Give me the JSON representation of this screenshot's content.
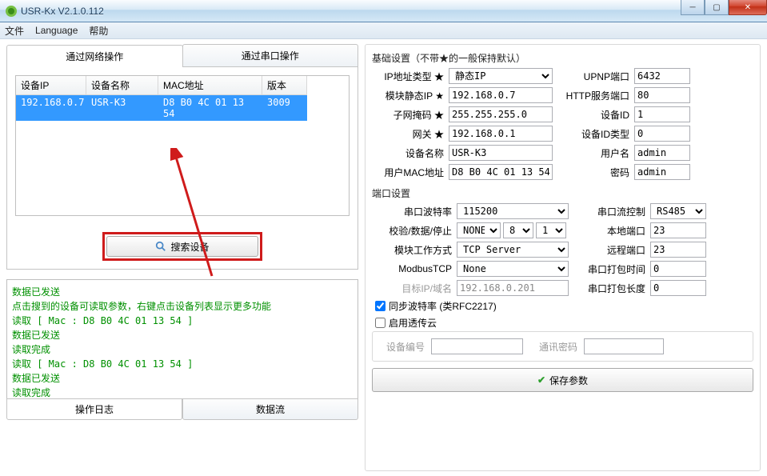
{
  "window": {
    "title": "USR-Kx V2.1.0.112"
  },
  "menu": {
    "file": "文件",
    "language": "Language",
    "help": "帮助"
  },
  "left": {
    "tabs": {
      "network": "通过网络操作",
      "serial": "通过串口操作"
    },
    "columns": {
      "ip": "设备IP",
      "name": "设备名称",
      "mac": "MAC地址",
      "ver": "版本"
    },
    "row": {
      "ip": "192.168.0.7",
      "name": "USR-K3",
      "mac": "D8 B0 4C 01 13 54",
      "ver": "3009"
    },
    "search_btn": "搜索设备",
    "log": [
      "数据已发送",
      "点击搜到的设备可读取参数，右键点击设备列表显示更多功能",
      "读取 [ Mac : D8 B0 4C 01 13 54 ]",
      "数据已发送",
      "读取完成",
      "读取 [ Mac : D8 B0 4C 01 13 54 ]",
      "数据已发送",
      "读取完成"
    ],
    "bottom_tabs": {
      "log": "操作日志",
      "data": "数据流"
    }
  },
  "right": {
    "basic_title": "基础设置（不带★的一般保持默认）",
    "basic": {
      "ip_type_label": "IP地址类型 ★",
      "ip_type_value": "静态IP",
      "upnp_port_label": "UPNP端口",
      "upnp_port_value": "6432",
      "static_ip_label": "模块静态IP ★",
      "static_ip_value": "192.168.0.7",
      "http_port_label": "HTTP服务端口",
      "http_port_value": "80",
      "subnet_label": "子网掩码 ★",
      "subnet_value": "255.255.255.0",
      "dev_id_label": "设备ID",
      "dev_id_value": "1",
      "gateway_label": "网关 ★",
      "gateway_value": "192.168.0.1",
      "dev_id_type_label": "设备ID类型",
      "dev_id_type_value": "0",
      "dev_name_label": "设备名称",
      "dev_name_value": "USR-K3",
      "username_label": "用户名",
      "username_value": "admin",
      "user_mac_label": "用户MAC地址",
      "user_mac_value": "D8 B0 4C 01 13 54",
      "password_label": "密码",
      "password_value": "admin"
    },
    "port_title": "端口设置",
    "port": {
      "baud_label": "串口波特率",
      "baud_value": "115200",
      "flow_label": "串口流控制",
      "flow_value": "RS485",
      "psp_label": "校验/数据/停止",
      "parity": "NONE",
      "databits": "8",
      "stopbits": "1",
      "local_port_label": "本地端口",
      "local_port_value": "23",
      "work_mode_label": "模块工作方式",
      "work_mode_value": "TCP Server",
      "remote_port_label": "远程端口",
      "remote_port_value": "23",
      "modbus_label": "ModbusTCP",
      "modbus_value": "None",
      "pack_time_label": "串口打包时间",
      "pack_time_value": "0",
      "target_host_label": "目标IP/域名",
      "target_host_value": "192.168.0.201",
      "pack_len_label": "串口打包长度",
      "pack_len_value": "0"
    },
    "sync_baud": "同步波特率 (类RFC2217)",
    "enable_cloud": "启用透传云",
    "cloud_id_label": "设备编号",
    "cloud_pwd_label": "通讯密码",
    "save_btn": "保存参数"
  }
}
